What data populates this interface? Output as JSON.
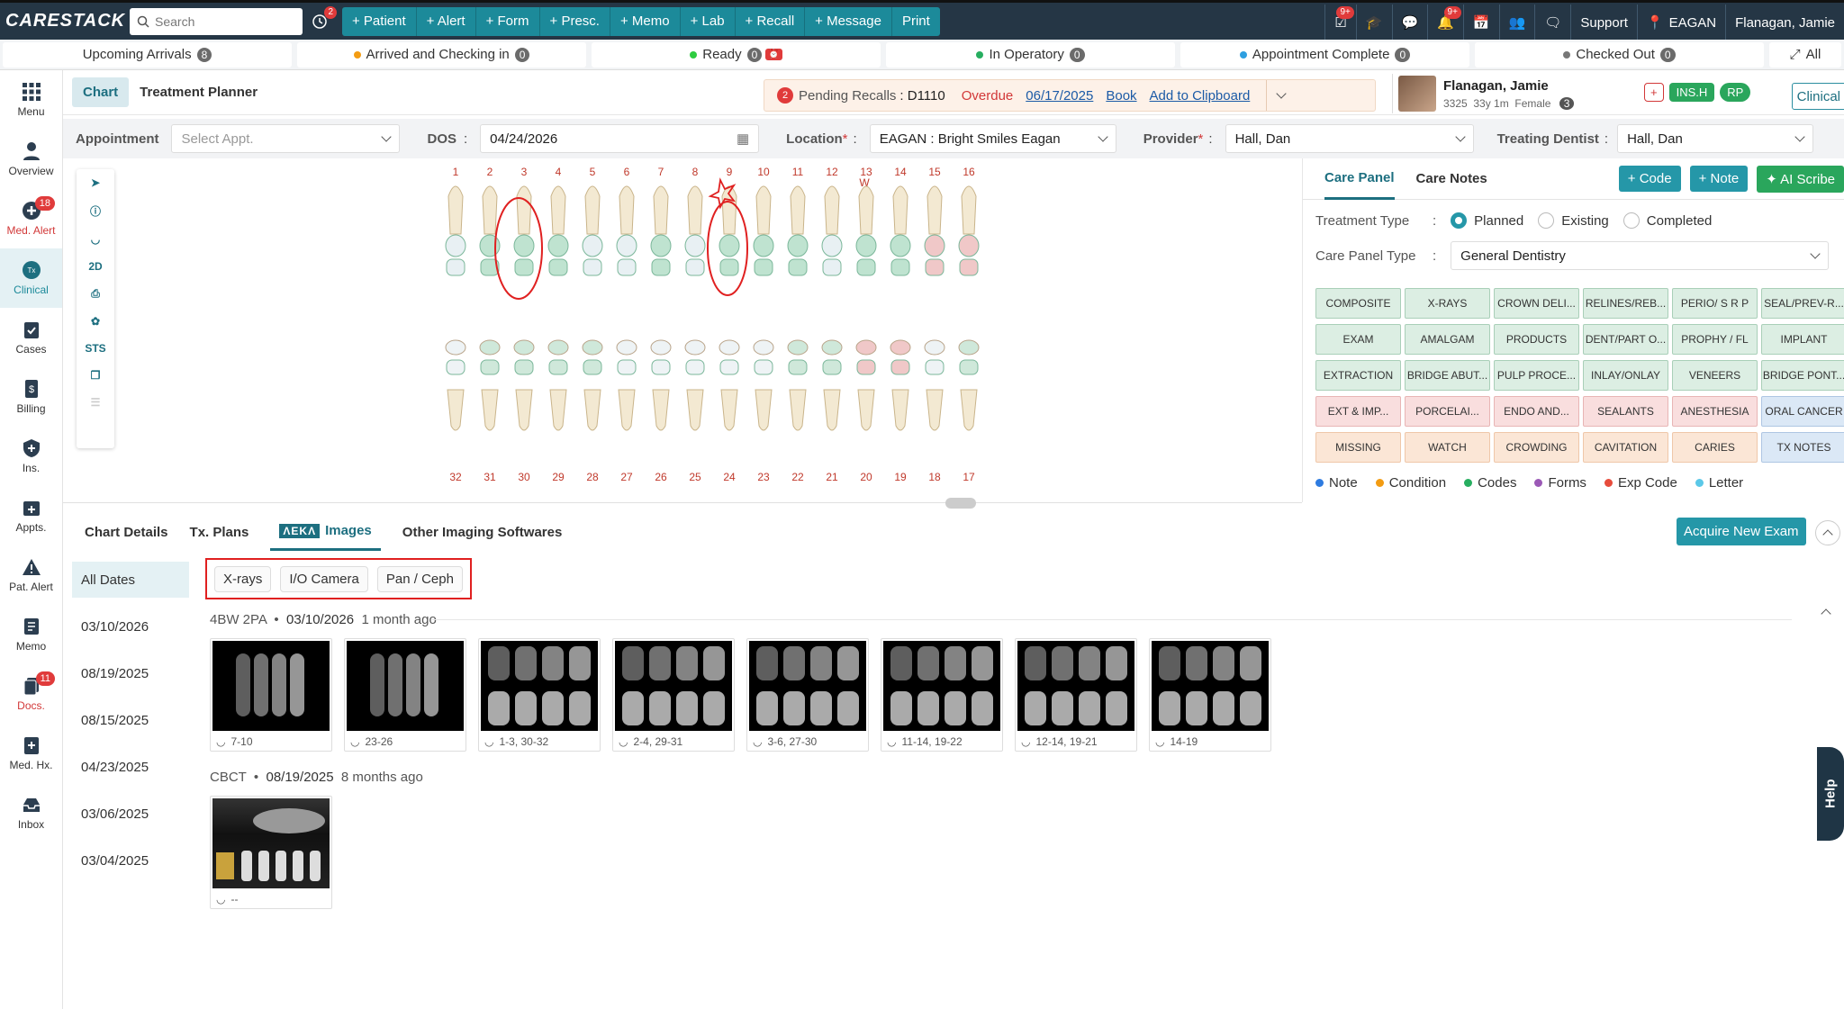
{
  "topbar": {
    "logo_a": "CARE",
    "logo_b": "STACK",
    "search_placeholder": "Search",
    "notif_badge": "2",
    "quick_actions": [
      "+ Patient",
      "+ Alert",
      "+ Form",
      "+ Presc.",
      "+ Memo",
      "+ Lab",
      "+ Recall",
      "+ Message",
      "Print"
    ],
    "badge_a": "9+",
    "badge_b": "9+",
    "support": "Support",
    "location": "EAGAN",
    "user": "Flanagan, Jamie"
  },
  "statusbar": [
    {
      "label": "Upcoming Arrivals",
      "count": "8",
      "dot": ""
    },
    {
      "label": "Arrived and Checking in",
      "count": "0",
      "dot": "#f39c12"
    },
    {
      "label": "Ready",
      "count": "0",
      "dot": "#2ecc40"
    },
    {
      "label": "In Operatory",
      "count": "0",
      "dot": "#27ae60"
    },
    {
      "label": "Appointment Complete",
      "count": "0",
      "dot": "#2e9fe0"
    },
    {
      "label": "Checked Out",
      "count": "0",
      "dot": "#777777"
    }
  ],
  "status_all": "All",
  "leftnav": [
    {
      "label": "Menu",
      "badge": ""
    },
    {
      "label": "Overview",
      "badge": ""
    },
    {
      "label": "Med. Alert",
      "badge": "18"
    },
    {
      "label": "Clinical",
      "badge": ""
    },
    {
      "label": "Cases",
      "badge": ""
    },
    {
      "label": "Billing",
      "badge": ""
    },
    {
      "label": "Ins.",
      "badge": ""
    },
    {
      "label": "Appts.",
      "badge": ""
    },
    {
      "label": "Pat. Alert",
      "badge": ""
    },
    {
      "label": "Memo",
      "badge": ""
    },
    {
      "label": "Docs.",
      "badge": "11"
    },
    {
      "label": "Med. Hx.",
      "badge": ""
    },
    {
      "label": "Inbox",
      "badge": ""
    }
  ],
  "header": {
    "tab_chart": "Chart",
    "tab_planner": "Treatment Planner",
    "recall_count": "2",
    "recall_label": "Pending Recalls",
    "recall_code": ": D1110",
    "overdue": "Overdue",
    "recall_date": "06/17/2025",
    "book": "Book",
    "clipboard": "Add to Clipboard",
    "patient_name": "Flanagan, Jamie",
    "patient_id": "3325",
    "patient_age": "33y 1m",
    "patient_sex": "Female",
    "patient_count": "3",
    "ins_plus": "+",
    "ins_h": "INS.H",
    "rp": "RP",
    "clinical_summary": "Clinical Summary"
  },
  "filters": {
    "appointment_label": "Appointment",
    "appointment_placeholder": "Select Appt.",
    "dos_label": "DOS",
    "dos_value": "04/24/2026",
    "location_label": "Location",
    "location_value": "EAGAN : Bright Smiles Eagan",
    "provider_label": "Provider",
    "provider_value": "Hall, Dan",
    "treating_label": "Treating Dentist",
    "treating_value": "Hall, Dan"
  },
  "tools": [
    "2D",
    "STS"
  ],
  "teeth": {
    "upper": [
      "1",
      "2",
      "3",
      "4",
      "5",
      "6",
      "7",
      "8",
      "9",
      "10",
      "11",
      "12",
      "13",
      "14",
      "15",
      "16"
    ],
    "lower": [
      "32",
      "31",
      "30",
      "29",
      "28",
      "27",
      "26",
      "25",
      "24",
      "23",
      "22",
      "21",
      "20",
      "19",
      "18",
      "17"
    ],
    "mark_13": "W"
  },
  "carepanel": {
    "tab_care_panel": "Care Panel",
    "tab_care_notes": "Care Notes",
    "btn_code": "+ Code",
    "btn_note": "+ Note",
    "btn_ai": "AI Scribe",
    "treatment_type_label": "Treatment Type",
    "planned": "Planned",
    "existing": "Existing",
    "completed": "Completed",
    "panel_type_label": "Care Panel Type",
    "panel_type_value": "General Dentistry",
    "buttons": [
      {
        "label": "COMPOSITE",
        "tone": "green"
      },
      {
        "label": "X-RAYS",
        "tone": "green"
      },
      {
        "label": "CROWN DELI...",
        "tone": "green"
      },
      {
        "label": "RELINES/REB...",
        "tone": "green"
      },
      {
        "label": "PERIO/ S R P",
        "tone": "green"
      },
      {
        "label": "SEAL/PREV-R...",
        "tone": "green"
      },
      {
        "label": "EXAM",
        "tone": "green"
      },
      {
        "label": "AMALGAM",
        "tone": "green"
      },
      {
        "label": "PRODUCTS",
        "tone": "green"
      },
      {
        "label": "DENT/PART O...",
        "tone": "green"
      },
      {
        "label": "PROPHY / FL",
        "tone": "green"
      },
      {
        "label": "IMPLANT",
        "tone": "green"
      },
      {
        "label": "EXTRACTION",
        "tone": "green"
      },
      {
        "label": "BRIDGE ABUT...",
        "tone": "green"
      },
      {
        "label": "PULP PROCE...",
        "tone": "green"
      },
      {
        "label": "INLAY/ONLAY",
        "tone": "green"
      },
      {
        "label": "VENEERS",
        "tone": "green"
      },
      {
        "label": "BRIDGE PONT...",
        "tone": "green"
      },
      {
        "label": "EXT & IMP...",
        "tone": "pink"
      },
      {
        "label": "PORCELAI...",
        "tone": "pink"
      },
      {
        "label": "ENDO AND...",
        "tone": "pink"
      },
      {
        "label": "SEALANTS",
        "tone": "pink"
      },
      {
        "label": "ANESTHESIA",
        "tone": "pink"
      },
      {
        "label": "ORAL CANCER",
        "tone": "blue"
      },
      {
        "label": "MISSING",
        "tone": "orange"
      },
      {
        "label": "WATCH",
        "tone": "orange"
      },
      {
        "label": "CROWDING",
        "tone": "orange"
      },
      {
        "label": "CAVITATION",
        "tone": "orange"
      },
      {
        "label": "CARIES",
        "tone": "orange"
      },
      {
        "label": "TX NOTES",
        "tone": "blue"
      }
    ],
    "legend": [
      {
        "label": "Note",
        "color": "#2e7be0"
      },
      {
        "label": "Condition",
        "color": "#f39c12"
      },
      {
        "label": "Codes",
        "color": "#27ae60"
      },
      {
        "label": "Forms",
        "color": "#9b59b6"
      },
      {
        "label": "Exp Code",
        "color": "#e74c3c"
      },
      {
        "label": "Letter",
        "color": "#5bc8e8"
      }
    ]
  },
  "imaging": {
    "tab_chart_details": "Chart Details",
    "tab_tx_plans": "Tx. Plans",
    "aeka": "ΛEKΛ",
    "tab_images": "Images",
    "tab_other": "Other Imaging Softwares",
    "acquire": "Acquire New Exam",
    "dates": [
      "All Dates",
      "03/10/2026",
      "08/19/2025",
      "08/15/2025",
      "04/23/2025",
      "03/06/2025",
      "03/04/2025"
    ],
    "filter_chips": [
      "X-rays",
      "I/O Camera",
      "Pan / Ceph"
    ],
    "group1": {
      "type": "4BW 2PA",
      "date": "03/10/2026",
      "ago": "1 month ago",
      "images": [
        "7-10",
        "23-26",
        "1-3, 30-32",
        "2-4, 29-31",
        "3-6, 27-30",
        "11-14, 19-22",
        "12-14, 19-21",
        "14-19"
      ]
    },
    "group2": {
      "type": "CBCT",
      "date": "08/19/2025",
      "ago": "8 months ago",
      "images": [
        "--"
      ]
    }
  },
  "help": "Help"
}
